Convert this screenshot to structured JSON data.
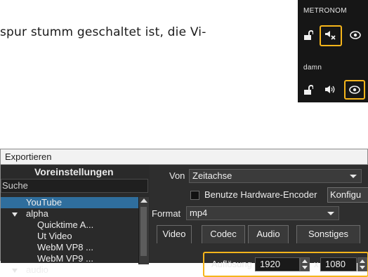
{
  "document": {
    "text_fragment": "spur stumm geschaltet ist, die Vi-"
  },
  "tracks": [
    {
      "name": "METRONOM",
      "audio_state": "muted",
      "lock_icon": "unlock-icon",
      "audio_icon": "speaker-muted-icon",
      "visibility_icon": "eye-icon"
    },
    {
      "name": "damn",
      "audio_state": "on",
      "lock_icon": "unlock-icon",
      "audio_icon": "speaker-on-icon",
      "visibility_icon": "eye-icon"
    }
  ],
  "highlight_color": "#f6b51b",
  "dialog": {
    "title": "Exportieren",
    "presets": {
      "header": "Voreinstellungen",
      "search_placeholder": "Suche",
      "items": [
        {
          "label": "YouTube",
          "selected": true,
          "level": 1
        },
        {
          "label": "alpha",
          "expanded": true,
          "level": 0
        },
        {
          "label": "Quicktime A...",
          "level": 2
        },
        {
          "label": "Ut Video",
          "level": 2
        },
        {
          "label": "WebM VP8 ...",
          "level": 2
        },
        {
          "label": "WebM VP9 ...",
          "level": 2
        },
        {
          "label": "audio",
          "expanded": true,
          "level": 0
        }
      ]
    },
    "from_label": "Von",
    "from_value": "Zeitachse",
    "hardware_encoder_label": "Benutze Hardware-Encoder",
    "hardware_encoder_checked": false,
    "configure_label": "Konfigu",
    "format_label": "Format",
    "format_value": "mp4",
    "tabs": [
      "Video",
      "Codec",
      "Audio",
      "Sonstiges"
    ],
    "active_tab": "Video",
    "resolution_label": "Auflösung",
    "width": "1920",
    "x_label": "x",
    "height": "1080"
  }
}
